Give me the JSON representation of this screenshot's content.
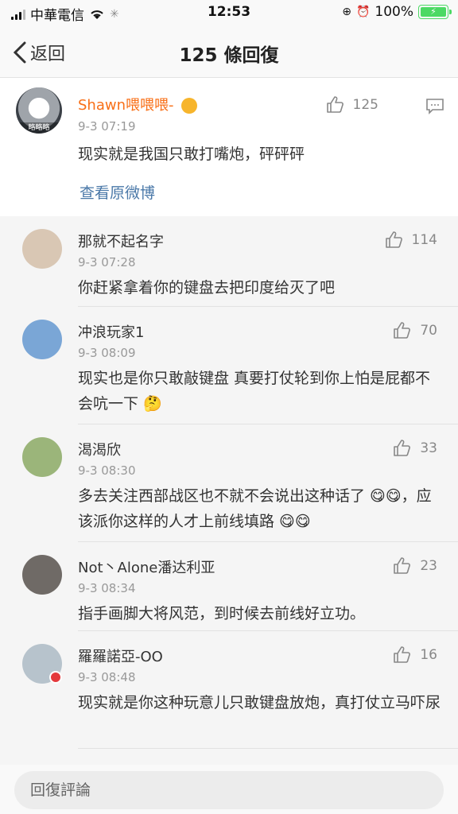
{
  "status_bar": {
    "carrier": "中華電信",
    "time": "12:53",
    "battery": "100%"
  },
  "nav": {
    "back_label": "返回",
    "title": "125 條回復"
  },
  "main_comment": {
    "username": "Shawn喂喂喂-",
    "avatar_tag": "略略略",
    "time": "9-3 07:19",
    "text": "现实就是我国只敢打嘴炮，砰砰砰",
    "likes": "125",
    "view_original": "查看原微博"
  },
  "replies": [
    {
      "username": "那就不起名字",
      "time": "9-3 07:28",
      "text": "你赶紧拿着你的键盘去把印度给灭了吧",
      "likes": "114",
      "avatar_color": "#d9c7b4"
    },
    {
      "username": "冲浪玩家1",
      "time": "9-3 08:09",
      "text": "现实也是你只敢敲键盘 真要打仗轮到你上怕是屁都不会吭一下 🤔",
      "likes": "70",
      "avatar_color": "#7aa6d6"
    },
    {
      "username": "渴渴欣",
      "time": "9-3 08:30",
      "text": "多去关注西部战区也不就不会说出这种话了 😋😋，应该派你这样的人才上前线填路 😋😋",
      "likes": "33",
      "avatar_color": "#9bb57a"
    },
    {
      "username": "Not丶Alone潘达利亚",
      "time": "9-3 08:34",
      "text": "指手画脚大将风范，到时候去前线好立功。",
      "likes": "23",
      "avatar_color": "#6f6a66"
    },
    {
      "username": "羅羅諾亞-OO",
      "time": "9-3 08:48",
      "text": "现实就是你这种玩意儿只敢键盘放炮，真打仗立马吓尿",
      "likes": "16",
      "avatar_color": "#b7c3cc"
    }
  ],
  "input": {
    "placeholder": "回復評論"
  },
  "colors": {
    "accent_orange": "#f86f17",
    "link_blue": "#4a78a8",
    "battery_green": "#4cd964"
  }
}
